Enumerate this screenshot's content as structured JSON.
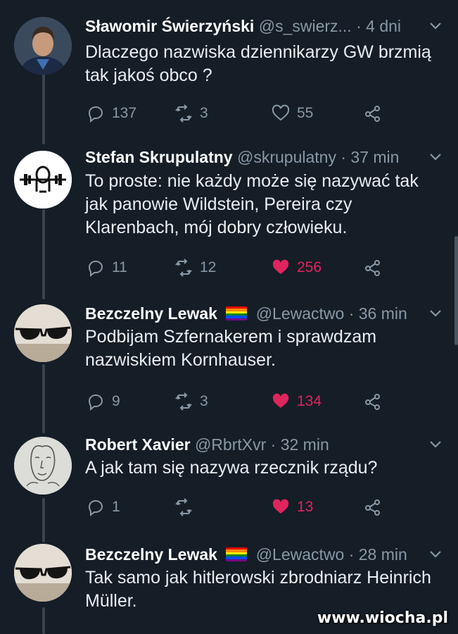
{
  "colors": {
    "background": "#151d27",
    "secondary_text": "#8899a6",
    "like_active": "#e0245e",
    "thread_line": "#38444d"
  },
  "tweets": [
    {
      "name": "Sławomir Świerzyński",
      "handle": "@s_swierz...",
      "time": "· 4 dni",
      "text": "Dlaczego nazwiska dziennikarzy GW brzmią tak jakoś obco ?",
      "replies": "137",
      "retweets": "3",
      "likes": "55",
      "liked": false,
      "avatar_icon": "man-portrait-avatar"
    },
    {
      "name": "Stefan Skrupulatny",
      "handle": "@skrupulatny",
      "time": "· 37 min",
      "text": "To proste: nie każdy może się nazywać tak jak panowie Wildstein, Pereira czy Klarenbach, mój dobry człowieku.",
      "replies": "11",
      "retweets": "12",
      "likes": "256",
      "liked": true,
      "avatar_icon": "weightlifter-logo-avatar"
    },
    {
      "name": "Bezczelny Lewak",
      "flag_icon": "rainbow-flag-icon",
      "handle": "@Lewactwo",
      "time": "· 36 min",
      "text": "Podbijam Szfernakerem i sprawdzam nazwiskiem Kornhauser.",
      "replies": "9",
      "retweets": "3",
      "likes": "134",
      "liked": true,
      "avatar_icon": "sunglasses-avatar"
    },
    {
      "name": "Robert Xavier",
      "handle": "@RbrtXvr",
      "time": "· 32 min",
      "text": "A jak tam się nazywa rzecznik rządu?",
      "replies": "1",
      "retweets": "",
      "likes": "13",
      "liked": true,
      "avatar_icon": "sketch-face-avatar"
    },
    {
      "name": "Bezczelny Lewak",
      "flag_icon": "rainbow-flag-icon",
      "handle": "@Lewactwo",
      "time": "· 28 min",
      "text": "Tak samo jak hitlerowski zbrodniarz Heinrich Müller.",
      "replies": "",
      "retweets": "",
      "likes": "",
      "liked": false,
      "avatar_icon": "sunglasses-avatar"
    }
  ],
  "watermark": "www.wiocha.pl"
}
